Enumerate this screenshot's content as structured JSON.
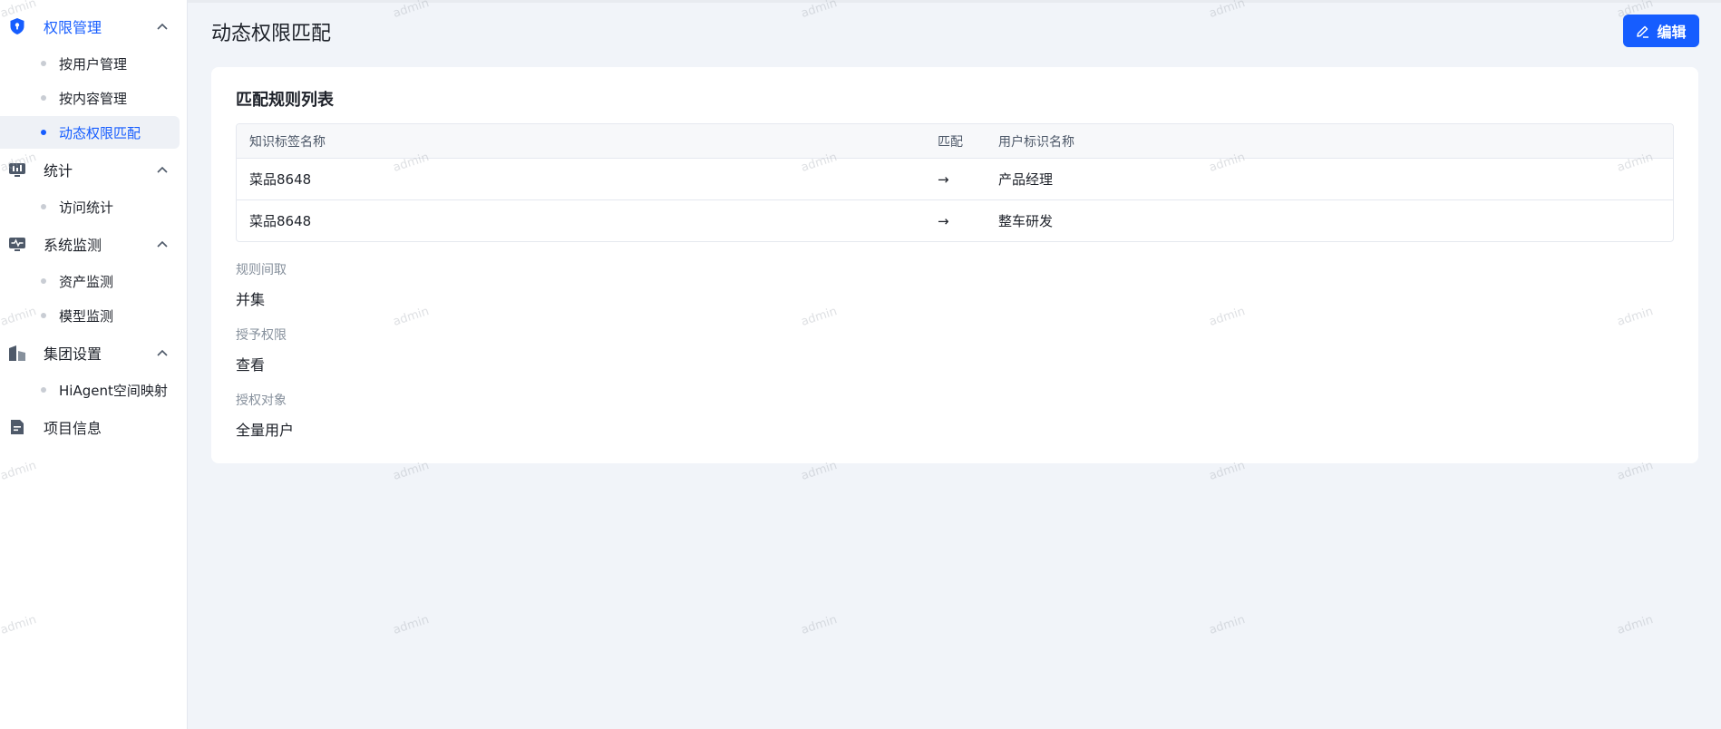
{
  "sidebar": {
    "groups": [
      {
        "label": "权限管理",
        "icon": "shield-icon",
        "expanded": true,
        "active": true,
        "items": [
          {
            "label": "按用户管理",
            "active": false
          },
          {
            "label": "按内容管理",
            "active": false
          },
          {
            "label": "动态权限匹配",
            "active": true
          }
        ]
      },
      {
        "label": "统计",
        "icon": "chart-icon",
        "expanded": true,
        "active": false,
        "items": [
          {
            "label": "访问统计",
            "active": false
          }
        ]
      },
      {
        "label": "系统监测",
        "icon": "monitor-icon",
        "expanded": true,
        "active": false,
        "items": [
          {
            "label": "资产监测",
            "active": false
          },
          {
            "label": "模型监测",
            "active": false
          }
        ]
      },
      {
        "label": "集团设置",
        "icon": "buildings-icon",
        "expanded": true,
        "active": false,
        "items": [
          {
            "label": "HiAgent空间映射",
            "active": false
          }
        ]
      },
      {
        "label": "项目信息",
        "icon": "document-icon",
        "expanded": false,
        "active": false,
        "items": []
      }
    ]
  },
  "header": {
    "title": "动态权限匹配",
    "edit_label": "编辑"
  },
  "card": {
    "title": "匹配规则列表",
    "table": {
      "columns": [
        "知识标签名称",
        "匹配",
        "用户标识名称"
      ],
      "rows": [
        {
          "tag": "菜品8648",
          "arrow": "→",
          "user": "产品经理"
        },
        {
          "tag": "菜品8648",
          "arrow": "→",
          "user": "整车研发"
        }
      ]
    },
    "fields": [
      {
        "label": "规则间取",
        "value": "并集"
      },
      {
        "label": "授予权限",
        "value": "查看"
      },
      {
        "label": "授权对象",
        "value": "全量用户"
      }
    ]
  },
  "watermark": {
    "text": "admin"
  },
  "colors": {
    "accent": "#165dff",
    "background": "#f1f4f9",
    "card": "#ffffff",
    "icon_gray": "#4e5969"
  }
}
